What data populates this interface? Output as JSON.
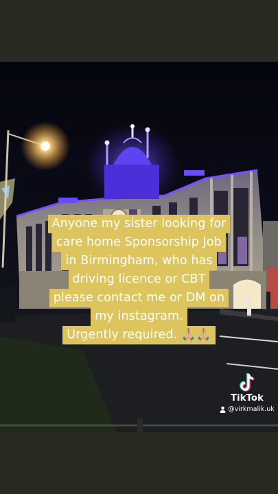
{
  "caption": {
    "lines": [
      "Anyone my sister looking for",
      "care home Sponsorship Job",
      "in Birmingham, who has",
      "driving licence or CBT",
      "please contact me or DM on",
      "my instagram.",
      "Urgently required. 🙏🏼🙏🏼"
    ]
  },
  "watermark": {
    "brand": "TikTok",
    "username": "@virkmalik.uk",
    "logo_icon": "tiktok-logo-icon",
    "user_icon": "person-icon"
  },
  "colors": {
    "caption_bg": "#ddc45c",
    "caption_text": "#ffffff",
    "dome_light": "#5a3ff0",
    "band": "#2b2a22"
  }
}
